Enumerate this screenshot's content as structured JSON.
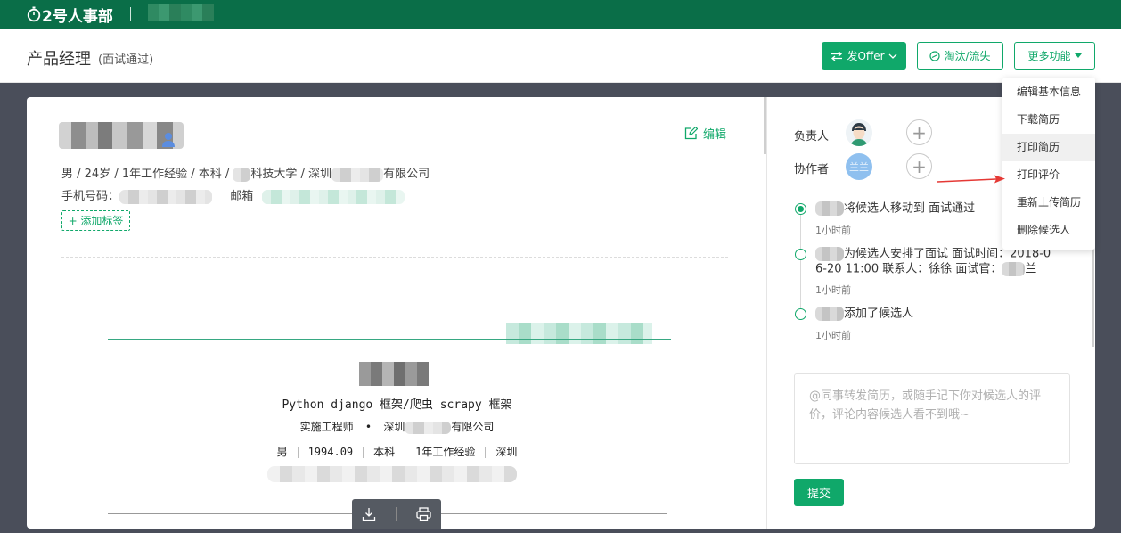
{
  "topbar": {
    "app_name": "2号人事部"
  },
  "header": {
    "title": "产品经理",
    "subtitle": "(面试通过)",
    "offer_button": "发Offer",
    "eliminate_button": "淘汰/流失",
    "more_button": "更多功能"
  },
  "candidate": {
    "edit_label": "编辑",
    "info": {
      "gender_age": "男 / 24岁 / 1年工作经验 / 本科 / ",
      "school_suffix": "科技大学 / 深圳",
      "company_suffix": "有限公司"
    },
    "phone_label": "手机号码：",
    "email_label": "邮箱",
    "add_tag": "+ 添加标签"
  },
  "resume": {
    "title_line": "Python django 框架/爬虫 scrapy 框架",
    "position": "实施工程师",
    "bullet": "•",
    "city_prefix": "深圳",
    "company_suffix": "有限公司",
    "gender": "男",
    "birth": "1994.09",
    "degree": "本科",
    "experience": "1年工作经验",
    "city": "深圳"
  },
  "right": {
    "owner_label": "负责人",
    "collab_label": "协作者",
    "collab_avatar_text": "兰兰",
    "timeline": [
      {
        "text": "将候选人移动到 面试通过",
        "time": "1小时前"
      },
      {
        "text_line1": "为候选人安排了面试 面试时间：2018-0",
        "text_line2": "6-20 11:00 联系人：徐徐 面试官：",
        "text_line2_suffix": "兰",
        "time": "1小时前"
      },
      {
        "text": "添加了候选人",
        "time": "1小时前"
      }
    ],
    "comment_placeholder": "@同事转发简历，或随手记下你对候选人的评价，评论内容候选人看不到哦~",
    "submit": "提交"
  },
  "dropdown": {
    "items": [
      "编辑基本信息",
      "下载简历",
      "打印简历",
      "打印评价",
      "重新上传简历",
      "删除候选人"
    ]
  },
  "colors": {
    "brand": "#0a6e48",
    "accent": "#10a86a",
    "backdrop": "#4a4e5a",
    "arrow": "#e53935"
  },
  "icons": [
    "stopwatch-icon",
    "swap-arrows-icon",
    "chevron-down-icon",
    "ban-icon",
    "caret-down-icon",
    "edit-icon",
    "male-icon",
    "download-icon",
    "print-icon",
    "plus-icon",
    "red-arrow-icon"
  ]
}
